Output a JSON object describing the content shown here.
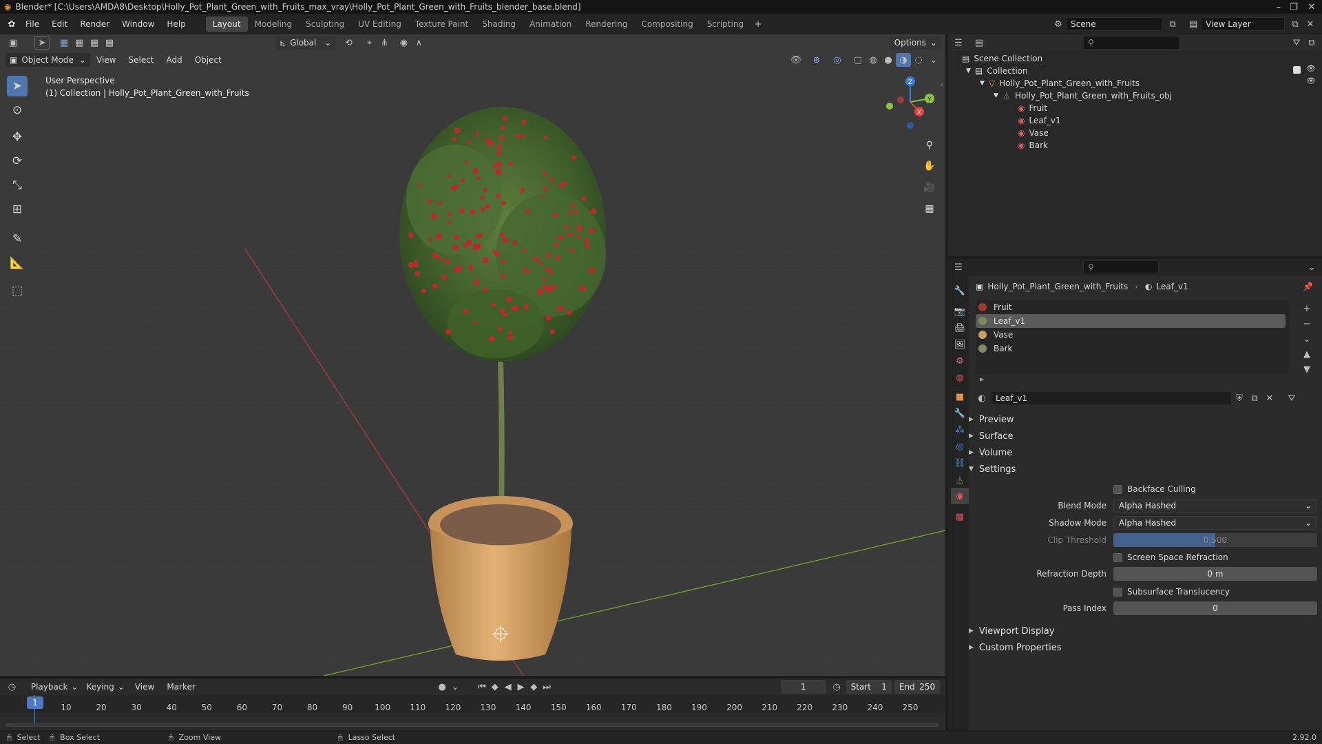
{
  "window": {
    "title": "Blender* [C:\\Users\\AMDA8\\Desktop\\Holly_Pot_Plant_Green_with_Fruits_max_vray\\Holly_Pot_Plant_Green_with_Fruits_blender_base.blend]"
  },
  "menu": [
    "File",
    "Edit",
    "Render",
    "Window",
    "Help"
  ],
  "workspaces": [
    "Layout",
    "Modeling",
    "Sculpting",
    "UV Editing",
    "Texture Paint",
    "Shading",
    "Animation",
    "Rendering",
    "Compositing",
    "Scripting"
  ],
  "active_workspace": "Layout",
  "scene": {
    "label": "Scene",
    "view_layer": "View Layer"
  },
  "viewport": {
    "mode": "Object Mode",
    "menus": [
      "View",
      "Select",
      "Add",
      "Object"
    ],
    "transform_orientation": "Global",
    "options_label": "Options",
    "overlay_line1": "User Perspective",
    "overlay_line2": "(1) Collection | Holly_Pot_Plant_Green_with_Fruits",
    "gizmo": {
      "x": "X",
      "y": "Y",
      "z": "Z"
    }
  },
  "outliner": {
    "scene_collection": "Scene Collection",
    "collection": "Collection",
    "object": "Holly_Pot_Plant_Green_with_Fruits",
    "mesh": "Holly_Pot_Plant_Green_with_Fruits_obj",
    "materials": [
      "Fruit",
      "Leaf_v1",
      "Vase",
      "Bark"
    ]
  },
  "properties": {
    "breadcrumb_object": "Holly_Pot_Plant_Green_with_Fruits",
    "breadcrumb_material": "Leaf_v1",
    "material_slots": [
      {
        "name": "Fruit",
        "color": "#a33a2e"
      },
      {
        "name": "Leaf_v1",
        "color": "#7a8a5a"
      },
      {
        "name": "Vase",
        "color": "#c9a15e"
      },
      {
        "name": "Bark",
        "color": "#7f8a6a"
      }
    ],
    "selected_slot": "Leaf_v1",
    "material_name": "Leaf_v1",
    "sections": {
      "preview": "Preview",
      "surface": "Surface",
      "volume": "Volume",
      "settings": "Settings",
      "viewport_display": "Viewport Display",
      "custom_properties": "Custom Properties"
    },
    "settings": {
      "backface_culling": "Backface Culling",
      "blend_mode_label": "Blend Mode",
      "blend_mode": "Alpha Hashed",
      "shadow_mode_label": "Shadow Mode",
      "shadow_mode": "Alpha Hashed",
      "clip_threshold_label": "Clip Threshold",
      "clip_threshold": "0.500",
      "screen_space_refraction": "Screen Space Refraction",
      "refraction_depth_label": "Refraction Depth",
      "refraction_depth": "0 m",
      "subsurface_translucency": "Subsurface Translucency",
      "pass_index_label": "Pass Index",
      "pass_index": "0"
    }
  },
  "timeline": {
    "menus": [
      "Playback",
      "Keying",
      "View",
      "Marker"
    ],
    "current_frame": "1",
    "start_label": "Start",
    "start": "1",
    "end_label": "End",
    "end": "250",
    "ticks": [
      "1",
      "10",
      "20",
      "30",
      "40",
      "50",
      "60",
      "70",
      "80",
      "90",
      "100",
      "110",
      "120",
      "130",
      "140",
      "150",
      "160",
      "170",
      "180",
      "190",
      "200",
      "210",
      "220",
      "230",
      "240",
      "250"
    ]
  },
  "statusbar": {
    "select": "Select",
    "box_select": "Box Select",
    "zoom_view": "Zoom View",
    "lasso_select": "Lasso Select",
    "version": "2.92.0"
  },
  "colors": {
    "accent": "#5076b0",
    "x_axis": "#e0443f",
    "y_axis": "#8bc43d",
    "z_axis": "#3d7cd6"
  }
}
